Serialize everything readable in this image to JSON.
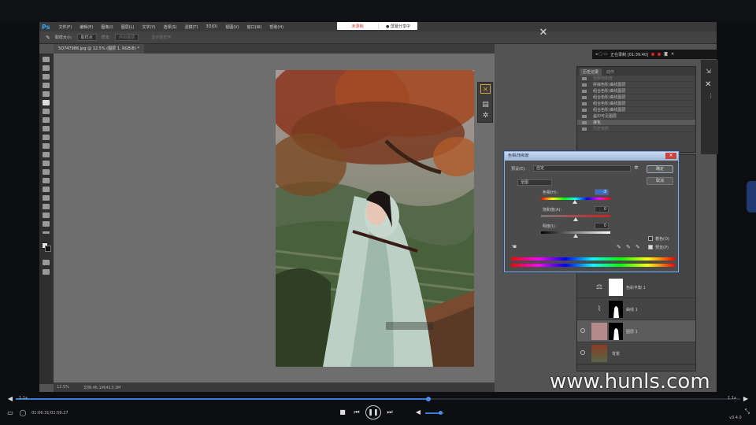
{
  "recorder": {
    "start_label": "未录制",
    "share_label": "● 屏幕分享中",
    "indicator": "正在录制 [01:39:40]"
  },
  "menu": {
    "logo": "Ps",
    "items": [
      "文件(F)",
      "编辑(E)",
      "图像(I)",
      "图层(L)",
      "文字(Y)",
      "选择(S)",
      "滤镜(T)",
      "3D(D)",
      "视图(V)",
      "窗口(W)",
      "帮助(H)"
    ]
  },
  "options": {
    "size_label": "取样大小:",
    "size_value": "取样点",
    "sample_label": "样本:",
    "sample_value": "所有图层",
    "ring_label": "显示取样环"
  },
  "document": {
    "tab": "5Q747986.jpg @ 12.5% (图层 1, RGB/8) *",
    "zoom": "12.5%",
    "doc_info": "文档:46.1M/413.3M"
  },
  "history": {
    "tabs": [
      "历史记录",
      "动作"
    ],
    "items": [
      {
        "label": "色相饱和度",
        "state": "dim"
      },
      {
        "label": "拼接色阶/曲线图层",
        "state": "normal"
      },
      {
        "label": "组合色阶/曲线图层",
        "state": "normal"
      },
      {
        "label": "组合色阶/曲线图层",
        "state": "normal"
      },
      {
        "label": "组合色阶/曲线图层",
        "state": "normal"
      },
      {
        "label": "组合色阶/曲线图层",
        "state": "normal"
      },
      {
        "label": "盖印可见图层",
        "state": "normal"
      },
      {
        "label": "液化",
        "state": "sel"
      },
      {
        "label": "历史快照",
        "state": "dim"
      }
    ]
  },
  "layers": [
    {
      "name": "色彩平衡 1",
      "thumb": "adjust"
    },
    {
      "name": "曲线 1",
      "thumb": "curve"
    },
    {
      "name": "图层 1",
      "thumb": "pink"
    },
    {
      "name": "背景",
      "thumb": "photo"
    }
  ],
  "dialog": {
    "title": "色相/饱和度",
    "preset_label": "预设(E):",
    "preset_value": "自定",
    "channel": "全图",
    "hue_label": "色相(H):",
    "hue_value": "-3",
    "sat_label": "饱和度(A):",
    "sat_value": "0",
    "light_label": "明度(I):",
    "light_value": "0",
    "ok": "确定",
    "cancel": "取消",
    "colorize": "着色(O)",
    "preview": "预览(P)",
    "hue_level": -3,
    "sat_level": 0,
    "light_level": 0
  },
  "player": {
    "time": "01:06:31/01:56:27",
    "speed_left": "1.1x",
    "speed_right": "1.1x",
    "version": "v3.4.0",
    "progress": 0.57,
    "volume": 0.8
  },
  "watermark": "www.hunls.com"
}
